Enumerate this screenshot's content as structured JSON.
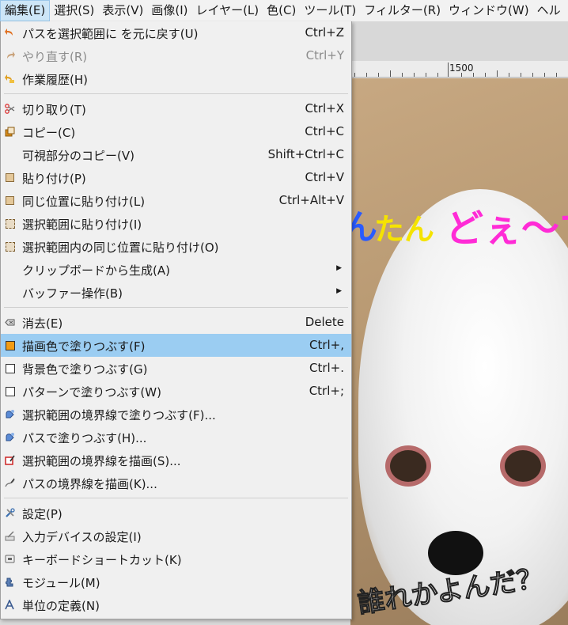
{
  "menubar": {
    "items": [
      {
        "label": "編集(E)"
      },
      {
        "label": "選択(S)"
      },
      {
        "label": "表示(V)"
      },
      {
        "label": "画像(I)"
      },
      {
        "label": "レイヤー(L)"
      },
      {
        "label": "色(C)"
      },
      {
        "label": "ツール(T)"
      },
      {
        "label": "フィルター(R)"
      },
      {
        "label": "ウィンドウ(W)"
      },
      {
        "label": "ヘル"
      }
    ]
  },
  "ruler": {
    "label": "1500"
  },
  "photo": {
    "text1": "ん",
    "text2": "たん",
    "text3": "どぇ〜す",
    "text4": "誰れかよんだ？"
  },
  "menu": {
    "items": [
      {
        "label": "パスを選択範囲に を元に戻す(U)",
        "shortcut": "Ctrl+Z",
        "icon": "undo-icon"
      },
      {
        "label": "やり直す(R)",
        "shortcut": "Ctrl+Y",
        "icon": "redo-icon"
      },
      {
        "label": "作業履歴(H)",
        "shortcut": "",
        "icon": "history-icon"
      },
      {
        "label": "切り取り(T)",
        "shortcut": "Ctrl+X",
        "icon": "scissors-icon"
      },
      {
        "label": "コピー(C)",
        "shortcut": "Ctrl+C",
        "icon": "copy-icon"
      },
      {
        "label": "可視部分のコピー(V)",
        "shortcut": "Shift+Ctrl+C",
        "icon": ""
      },
      {
        "label": "貼り付け(P)",
        "shortcut": "Ctrl+V",
        "icon": "paste-icon"
      },
      {
        "label": "同じ位置に貼り付け(L)",
        "shortcut": "Ctrl+Alt+V",
        "icon": "paste-in-place-icon"
      },
      {
        "label": "選択範囲に貼り付け(I)",
        "shortcut": "",
        "icon": "paste-into-icon"
      },
      {
        "label": "選択範囲内の同じ位置に貼り付け(O)",
        "shortcut": "",
        "icon": "paste-into-in-place-icon"
      },
      {
        "label": "クリップボードから生成(A)",
        "shortcut": "",
        "icon": ""
      },
      {
        "label": "バッファー操作(B)",
        "shortcut": "",
        "icon": ""
      },
      {
        "label": "消去(E)",
        "shortcut": "Delete",
        "icon": "clear-icon"
      },
      {
        "label": "描画色で塗りつぶす(F)",
        "shortcut": "Ctrl+,",
        "icon": "fg-fill-icon"
      },
      {
        "label": "背景色で塗りつぶす(G)",
        "shortcut": "Ctrl+.",
        "icon": "bg-fill-icon"
      },
      {
        "label": "パターンで塗りつぶす(W)",
        "shortcut": "Ctrl+;",
        "icon": "pattern-fill-icon"
      },
      {
        "label": "選択範囲の境界線で塗りつぶす(F)...",
        "shortcut": "",
        "icon": "fill-selection-icon"
      },
      {
        "label": "パスで塗りつぶす(H)...",
        "shortcut": "",
        "icon": "fill-path-icon"
      },
      {
        "label": "選択範囲の境界線を描画(S)...",
        "shortcut": "",
        "icon": "stroke-selection-icon"
      },
      {
        "label": "パスの境界線を描画(K)...",
        "shortcut": "",
        "icon": "stroke-path-icon"
      },
      {
        "label": "設定(P)",
        "shortcut": "",
        "icon": "preferences-icon"
      },
      {
        "label": "入力デバイスの設定(I)",
        "shortcut": "",
        "icon": "input-devices-icon"
      },
      {
        "label": "キーボードショートカット(K)",
        "shortcut": "",
        "icon": "keyboard-icon"
      },
      {
        "label": "モジュール(M)",
        "shortcut": "",
        "icon": "modules-icon"
      },
      {
        "label": "単位の定義(N)",
        "shortcut": "",
        "icon": "units-icon"
      }
    ]
  }
}
